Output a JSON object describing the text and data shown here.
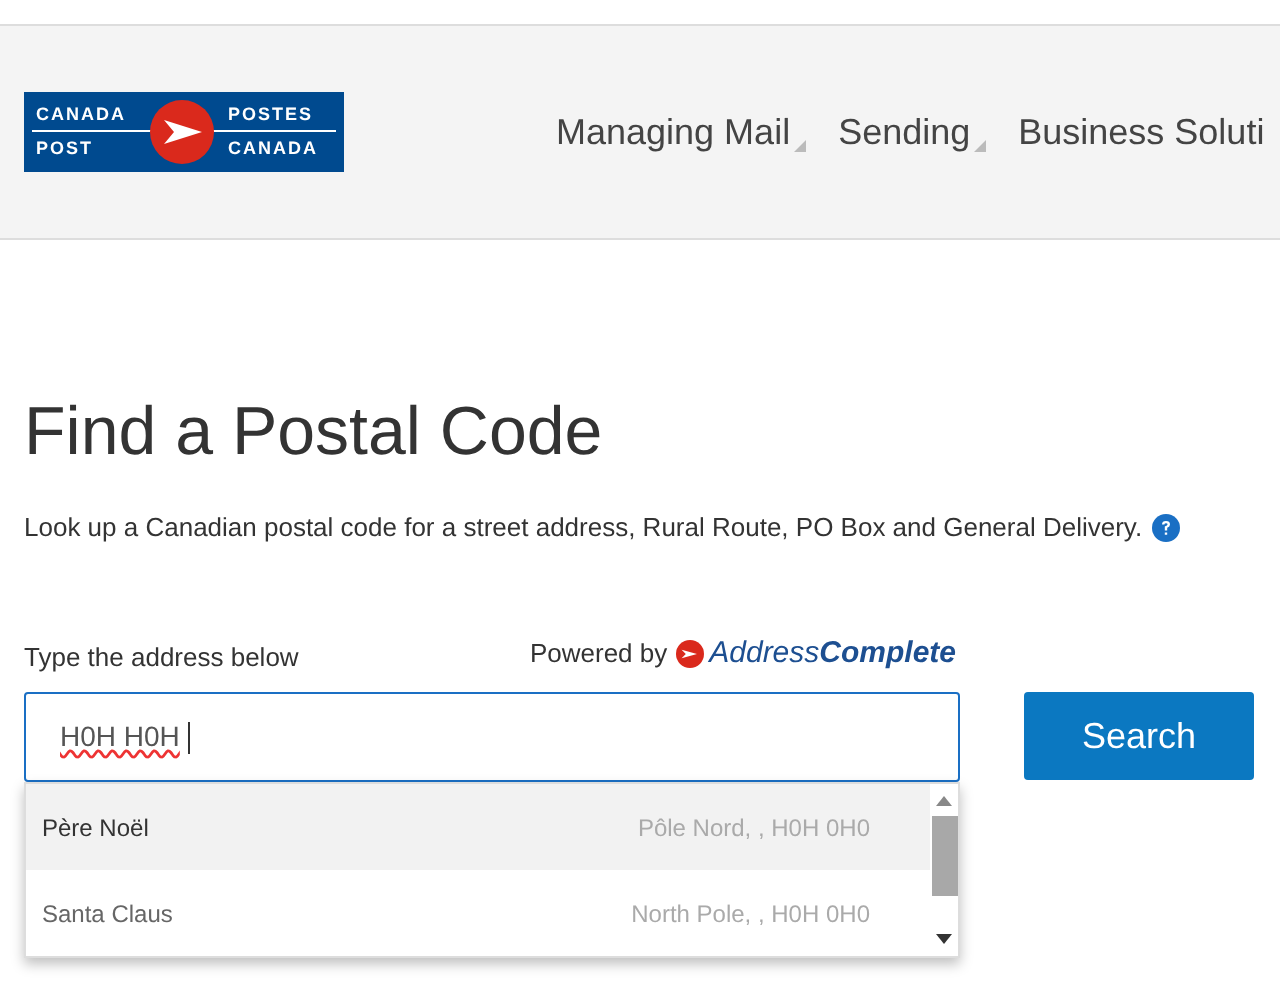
{
  "header": {
    "logo": {
      "top_left": "CANADA",
      "top_right": "POSTES",
      "bottom_left": "POST",
      "bottom_right": "CANADA"
    },
    "nav": [
      {
        "label": "Managing Mail",
        "has_menu": true
      },
      {
        "label": "Sending",
        "has_menu": true
      },
      {
        "label": "Business Soluti",
        "has_menu": false
      }
    ]
  },
  "title": "Find a Postal Code",
  "description": "Look up a Canadian postal code for a street address, Rural Route, PO Box and General Delivery.",
  "form": {
    "label": "Type the address below",
    "powered_by": "Powered by",
    "brand_light": "Address",
    "brand_bold": "Complete",
    "value": "H0H H0H",
    "button": "Search"
  },
  "suggestions": [
    {
      "name": "Père Noël",
      "detail": "Pôle Nord, , H0H 0H0",
      "selected": true
    },
    {
      "name": "Santa Claus",
      "detail": "North Pole, , H0H 0H0",
      "selected": false
    }
  ]
}
